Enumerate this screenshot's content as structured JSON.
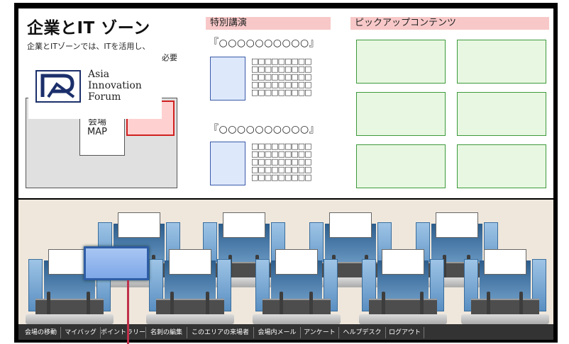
{
  "zone": {
    "title": "企業とIT ゾーン",
    "description": "企業とITゾーンでは、ITを活用し、",
    "description_tail": "必要"
  },
  "logo": {
    "line1": "Asia",
    "line2": "Innovation",
    "line3": "Forum"
  },
  "map": {
    "label_line1": "会場",
    "label_line2": "MAP"
  },
  "lecture": {
    "header": "特別講演",
    "items": [
      {
        "title": "『○○○○○○○○○○』",
        "lines": [
          "□□□□□□□□□",
          "□□□□□□□□□",
          "□□□□□□□□□",
          "□□□□□□□□□",
          "□□□□□□□□□"
        ]
      },
      {
        "title": "『○○○○○○○○○○』",
        "lines": [
          "□□□□□□□□□",
          "□□□□□□□□□",
          "□□□□□□□□□",
          "□□□□□□□□□",
          "□□□□□□□□□"
        ]
      }
    ]
  },
  "pickup": {
    "header": "ピックアップコンテンツ"
  },
  "nav": {
    "items": [
      "会場の移動",
      "マイバッグ",
      "ポイントラリー",
      "名刺の編集",
      "このエリアの来場者",
      "会場内メール",
      "アンケート",
      "ヘルプデスク",
      "ログアウト"
    ]
  },
  "colors": {
    "pickup_fill": "#e8f7e1",
    "pickup_border": "#3c9a3c",
    "header_pink": "#f8c8c8",
    "selected_booth": "#7ea7e8",
    "pointer": "#c0304a"
  }
}
